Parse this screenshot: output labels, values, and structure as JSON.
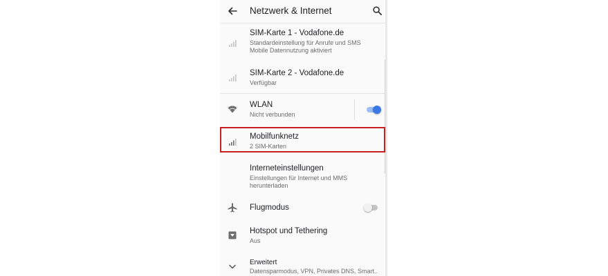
{
  "appbar": {
    "title": "Netzwerk & Internet",
    "back_icon": "arrow-back-icon",
    "search_icon": "search-icon"
  },
  "items": [
    {
      "title": "SIM-Karte 1 - Vodafone.de",
      "line1": "Standardeinstellung für Anrufe und SMS",
      "line2": "Mobile Datennutzung aktiviert",
      "icon": "signal-bars-icon"
    },
    {
      "title": "SIM-Karte 2 - Vodafone.de",
      "line1": "Verfügbar",
      "icon": "signal-bars-icon"
    },
    {
      "title": "WLAN",
      "line1": "Nicht verbunden",
      "icon": "wifi-icon",
      "toggle": true
    },
    {
      "title": "Mobilfunknetz",
      "line1": "2 SIM-Karten",
      "icon": "signal-bars-icon"
    },
    {
      "title": "Interneteinstellungen",
      "line1": "Einstellungen für Internet und MMS",
      "line2": "herunterladen"
    },
    {
      "title": "Flugmodus",
      "icon": "airplane-icon",
      "toggle": false
    },
    {
      "title": "Hotspot und Tethering",
      "line1": "Aus",
      "icon": "hotspot-icon"
    },
    {
      "title": "Erweitert",
      "line1": "Datensparmodus, VPN, Privates DNS, Smart..",
      "icon": "chevron-down-icon"
    }
  ],
  "colors": {
    "accent": "#3b78e7",
    "highlight": "#c81e1e"
  }
}
